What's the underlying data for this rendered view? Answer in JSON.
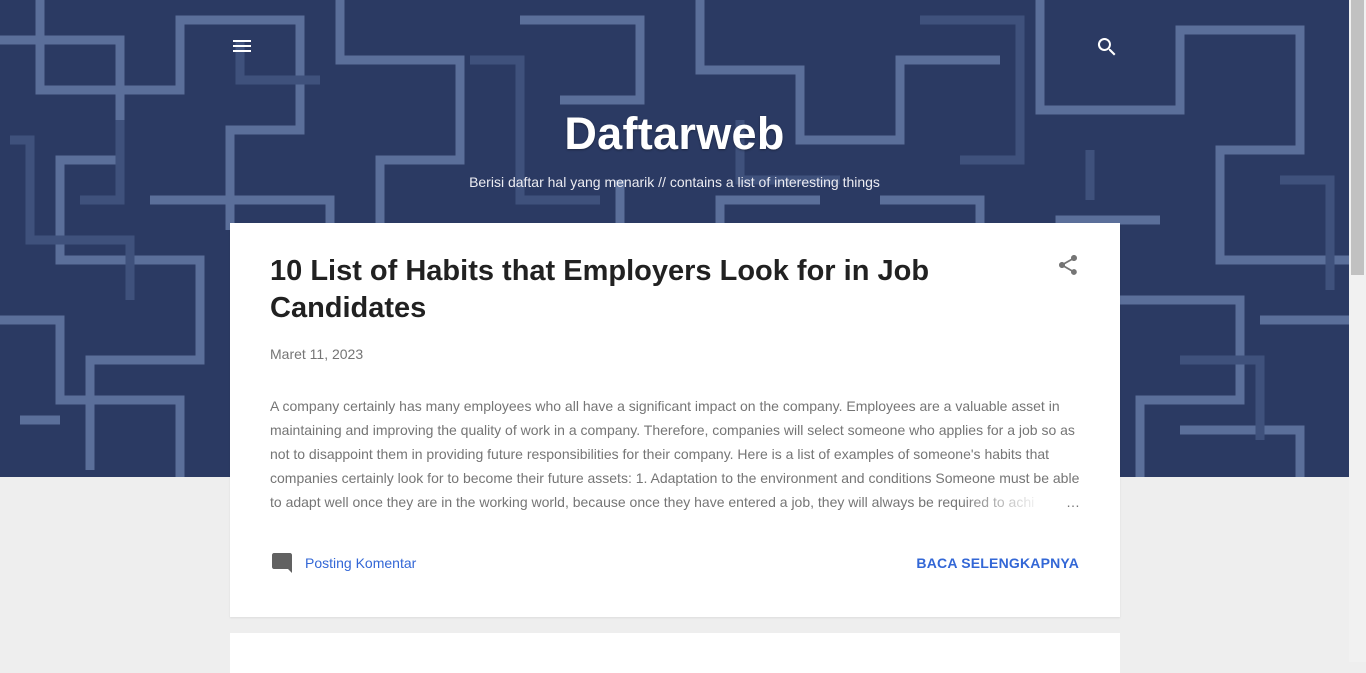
{
  "header": {
    "title": "Daftarweb",
    "description": "Berisi daftar hal yang menarik // contains a list of interesting things",
    "background_color": "#2b3a63",
    "menu_icon": "menu-icon",
    "search_icon": "search-icon"
  },
  "post": {
    "title": "10 List of Habits that Employers Look for in Job Candidates",
    "date": "Maret 11, 2023",
    "snippet": "A company certainly has many employees who all have a significant impact on the company. Employees are a valuable asset in maintaining and improving the quality of work in a company. Therefore, companies will select someone who applies for a job so as not to disappoint them in providing future responsibilities for their company. Here is a list of examples of someone's habits that companies certainly look for to become their future assets: 1.   Adaptation to the environment and conditions Someone must be able to adapt well once they are in the working world, because once they have entered a job, they will always be required to achi",
    "ellipsis": "…",
    "comment_label": "Posting Komentar",
    "read_more_label": "BACA SELENGKAPNYA",
    "share_icon": "share-icon",
    "comment_icon": "comment-icon"
  },
  "colors": {
    "link": "#3367d6",
    "title_text": "#212121",
    "meta_text": "#757575",
    "page_background": "#eeeeee"
  }
}
